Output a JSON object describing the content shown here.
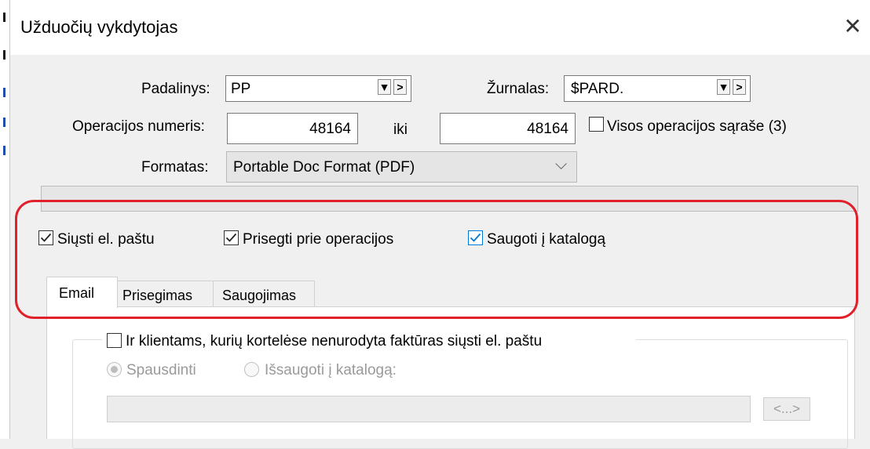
{
  "window": {
    "title": "Užduočių vykdytojas",
    "close_symbol": "✕"
  },
  "form": {
    "padalinys": {
      "label": "Padalinys:",
      "value": "PP"
    },
    "zurnalas": {
      "label": "Žurnalas:",
      "value": "$PARD."
    },
    "combo_buttons": {
      "filter": "▼",
      "next": ">"
    },
    "operacijos": {
      "label": "Operacijos numeris:",
      "from": "48164",
      "to_label": "iki",
      "to": "48164"
    },
    "visos": {
      "label": "Visos operacijos sąraše (3)",
      "checked": false
    },
    "formatas": {
      "label": "Formatas:",
      "value": "Portable Doc Format (PDF)",
      "chevron": "⌵"
    }
  },
  "options": {
    "siusti": {
      "label": "Siųsti el. paštu",
      "checked": true
    },
    "prisegti": {
      "label": "Prisegti prie operacijos",
      "checked": true
    },
    "saugoti": {
      "label": "Saugoti į katalogą",
      "checked": true
    }
  },
  "tabs": [
    {
      "label": "Email",
      "active": true
    },
    {
      "label": "Prisegimas",
      "active": false
    },
    {
      "label": "Saugojimas",
      "active": false
    }
  ],
  "email_tab": {
    "ir_klientams": {
      "label": "Ir klientams, kurių kortelėse nenurodyta faktūras siųsti el. paštu",
      "checked": false
    },
    "spausdinti": {
      "label": "Spausdinti",
      "selected": true,
      "enabled": false
    },
    "issaugoti": {
      "label": "Išsaugoti į katalogą:",
      "selected": false,
      "enabled": false
    },
    "path_value": "",
    "browse_label": "<...>"
  },
  "colors": {
    "highlight": "#e0202a",
    "checkbox_blue": "#0078d7"
  }
}
